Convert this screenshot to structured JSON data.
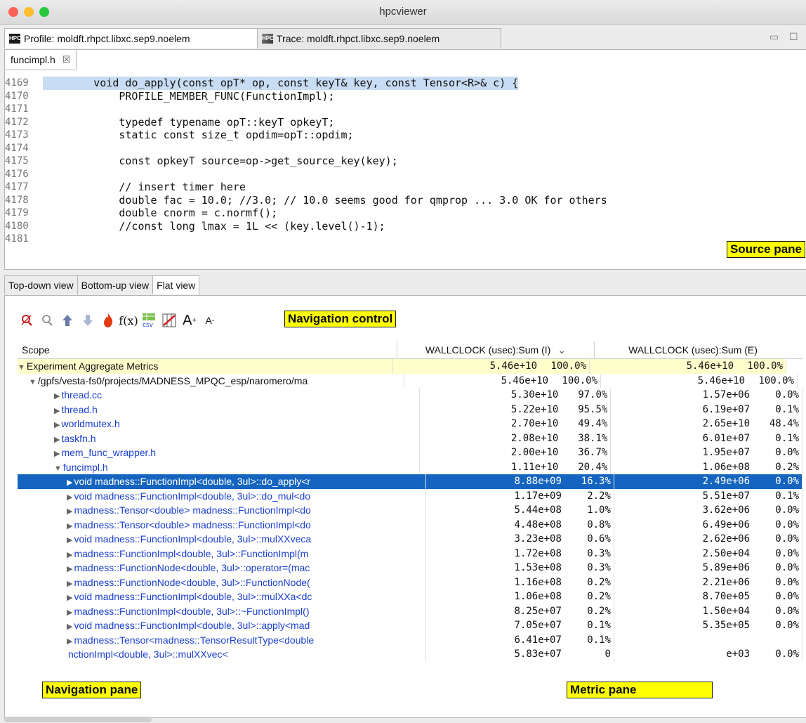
{
  "window": {
    "title": "hpcviewer"
  },
  "editor_tabs": [
    {
      "label": "Profile: moldft.rhpct.libxc.sep9.noelem",
      "icon_text": "HPC"
    },
    {
      "label": "Trace: moldft.rhpct.libxc.sep9.noelem",
      "icon_text": "HPC"
    }
  ],
  "window_controls": {
    "minimize": "▭",
    "maximize": "☐"
  },
  "source": {
    "tab": "funcimpl.h",
    "tab_close": "☒",
    "label": "Source pane",
    "lines": [
      {
        "n": "4169",
        "text": "        void do_apply(const opT* op, const keyT& key, const Tensor<R>& c) {"
      },
      {
        "n": "4170",
        "text": "            PROFILE_MEMBER_FUNC(FunctionImpl);"
      },
      {
        "n": "4171",
        "text": ""
      },
      {
        "n": "4172",
        "text": "            typedef typename opT::keyT opkeyT;"
      },
      {
        "n": "4173",
        "text": "            static const size_t opdim=opT::opdim;"
      },
      {
        "n": "4174",
        "text": ""
      },
      {
        "n": "4175",
        "text": "            const opkeyT source=op->get_source_key(key);"
      },
      {
        "n": "4176",
        "text": ""
      },
      {
        "n": "4177",
        "text": "            // insert timer here"
      },
      {
        "n": "4178",
        "text": "            double fac = 10.0; //3.0; // 10.0 seems good for qmprop ... 3.0 OK for others"
      },
      {
        "n": "4179",
        "text": "            double cnorm = c.normf();"
      },
      {
        "n": "4180",
        "text": "            //const long lmax = 1L << (key.level()-1);"
      },
      {
        "n": "4181",
        "text": ""
      }
    ]
  },
  "view_tabs": [
    "Top-down view",
    "Bottom-up view",
    "Flat view"
  ],
  "navigation_control_label": "Navigation control",
  "navigation_pane_label": "Navigation pane",
  "metric_pane_label": "Metric pane",
  "toolbar_icons": [
    "zoom-in-icon",
    "zoom-out-icon",
    "flatten-icon",
    "unflatten-icon",
    "hot-path-icon",
    "derived-metric-icon",
    "csv-export-icon",
    "metric-columns-icon",
    "font-increase-icon",
    "font-decrease-icon"
  ],
  "table": {
    "headers": {
      "scope": "Scope",
      "m1": "WALLCLOCK (usec):Sum (I)",
      "m1_sort": "⌄",
      "m2": "WALLCLOCK (usec):Sum (E)"
    },
    "rows": [
      {
        "scope": "Experiment Aggregate Metrics",
        "tri": "▼",
        "indent": 0,
        "link": false,
        "i": "5.46e+10",
        "ip": "100.0%",
        "e": "5.46e+10",
        "ep": "100.0%"
      },
      {
        "scope": "/gpfs/vesta-fs0/projects/MADNESS_MPQC_esp/naromero/ma",
        "tri": "▼",
        "indent": 1,
        "link": false,
        "i": "5.46e+10",
        "ip": "100.0%",
        "e": "5.46e+10",
        "ep": "100.0%"
      },
      {
        "scope": "thread.cc",
        "tri": "▶",
        "indent": 2,
        "link": true,
        "i": "5.30e+10",
        "ip": "97.0%",
        "e": "1.57e+06",
        "ep": "0.0%"
      },
      {
        "scope": "thread.h",
        "tri": "▶",
        "indent": 2,
        "link": true,
        "i": "5.22e+10",
        "ip": "95.5%",
        "e": "6.19e+07",
        "ep": "0.1%"
      },
      {
        "scope": "worldmutex.h",
        "tri": "▶",
        "indent": 2,
        "link": true,
        "i": "2.70e+10",
        "ip": "49.4%",
        "e": "2.65e+10",
        "ep": "48.4%"
      },
      {
        "scope": "taskfn.h",
        "tri": "▶",
        "indent": 2,
        "link": true,
        "i": "2.08e+10",
        "ip": "38.1%",
        "e": "6.01e+07",
        "ep": "0.1%"
      },
      {
        "scope": "mem_func_wrapper.h",
        "tri": "▶",
        "indent": 2,
        "link": true,
        "i": "2.00e+10",
        "ip": "36.7%",
        "e": "1.95e+07",
        "ep": "0.0%"
      },
      {
        "scope": "funcimpl.h",
        "tri": "▼",
        "indent": 2,
        "link": true,
        "i": "1.11e+10",
        "ip": "20.4%",
        "e": "1.06e+08",
        "ep": "0.2%"
      },
      {
        "scope": "void madness::FunctionImpl<double, 3ul>::do_apply<r",
        "tri": "▶",
        "indent": 3,
        "link": true,
        "sel": true,
        "i": "8.88e+09",
        "ip": "16.3%",
        "e": "2.49e+06",
        "ep": "0.0%"
      },
      {
        "scope": "void madness::FunctionImpl<double, 3ul>::do_mul<do",
        "tri": "▶",
        "indent": 3,
        "link": true,
        "i": "1.17e+09",
        "ip": "2.2%",
        "e": "5.51e+07",
        "ep": "0.1%"
      },
      {
        "scope": "madness::Tensor<double> madness::FunctionImpl<do",
        "tri": "▶",
        "indent": 3,
        "link": true,
        "i": "5.44e+08",
        "ip": "1.0%",
        "e": "3.62e+06",
        "ep": "0.0%"
      },
      {
        "scope": "madness::Tensor<double> madness::FunctionImpl<do",
        "tri": "▶",
        "indent": 3,
        "link": true,
        "i": "4.48e+08",
        "ip": "0.8%",
        "e": "6.49e+06",
        "ep": "0.0%"
      },
      {
        "scope": "void madness::FunctionImpl<double, 3ul>::mulXXveca",
        "tri": "▶",
        "indent": 3,
        "link": true,
        "i": "3.23e+08",
        "ip": "0.6%",
        "e": "2.62e+06",
        "ep": "0.0%"
      },
      {
        "scope": "madness::FunctionImpl<double, 3ul>::FunctionImpl(m",
        "tri": "▶",
        "indent": 3,
        "link": true,
        "i": "1.72e+08",
        "ip": "0.3%",
        "e": "2.50e+04",
        "ep": "0.0%"
      },
      {
        "scope": "madness::FunctionNode<double, 3ul>::operator=(mac",
        "tri": "▶",
        "indent": 3,
        "link": true,
        "i": "1.53e+08",
        "ip": "0.3%",
        "e": "5.89e+06",
        "ep": "0.0%"
      },
      {
        "scope": "madness::FunctionNode<double, 3ul>::FunctionNode(",
        "tri": "▶",
        "indent": 3,
        "link": true,
        "i": "1.16e+08",
        "ip": "0.2%",
        "e": "2.21e+06",
        "ep": "0.0%"
      },
      {
        "scope": "void madness::FunctionImpl<double, 3ul>::mulXXa<dc",
        "tri": "▶",
        "indent": 3,
        "link": true,
        "i": "1.06e+08",
        "ip": "0.2%",
        "e": "8.70e+05",
        "ep": "0.0%"
      },
      {
        "scope": "madness::FunctionImpl<double, 3ul>::~FunctionImpl()",
        "tri": "▶",
        "indent": 3,
        "link": true,
        "i": "8.25e+07",
        "ip": "0.2%",
        "e": "1.50e+04",
        "ep": "0.0%"
      },
      {
        "scope": "void madness::FunctionImpl<double, 3ul>::apply<mad",
        "tri": "▶",
        "indent": 3,
        "link": true,
        "i": "7.05e+07",
        "ip": "0.1%",
        "e": "5.35e+05",
        "ep": "0.0%"
      },
      {
        "scope": "madness::Tensor<madness::TensorResultType<double",
        "tri": "▶",
        "indent": 3,
        "link": true,
        "i": "6.41e+07",
        "ip": "0.1%",
        "e": "",
        "ep": ""
      },
      {
        "scope": "nctionImpl<double, 3ul>::mulXXvec<",
        "tri": "",
        "indent": 3,
        "link": true,
        "i": "5.83e+07",
        "ip": "0",
        "e": "e+03",
        "ep": "0.0%"
      }
    ]
  },
  "colors": {
    "close": "#fe5f57",
    "minimize": "#febc2e",
    "zoom": "#28c840",
    "selection": "#1565c0",
    "highlight": "#c8dcf4",
    "label": "#ffff00"
  }
}
